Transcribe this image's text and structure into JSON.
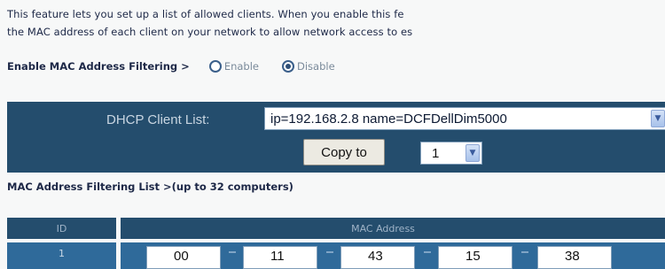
{
  "intro": {
    "line1": "This feature lets you set up a list of allowed clients. When you enable this fe",
    "line2": "the MAC address of each client on your network to allow network access to es"
  },
  "mac_filter": {
    "label": "Enable MAC Address Filtering >",
    "options": [
      "Enable",
      "Disable"
    ],
    "selected": "Disable"
  },
  "dhcp": {
    "label": "DHCP Client List:",
    "selected_value": "ip=192.168.2.8 name=DCFDellDim5000",
    "copy_button": "Copy to",
    "slot_value": "1"
  },
  "list": {
    "title": "MAC Address Filtering List >(up to 32 computers)",
    "columns": [
      "ID",
      "MAC Address"
    ],
    "rows": [
      {
        "id": "1",
        "mac": [
          "00",
          "11",
          "43",
          "15",
          "38"
        ]
      }
    ]
  },
  "colors": {
    "band": "#244d6d",
    "row": "#2f6a9a",
    "text": "#1d2847"
  },
  "icons": {
    "dropdown": "chevron-down-icon"
  }
}
